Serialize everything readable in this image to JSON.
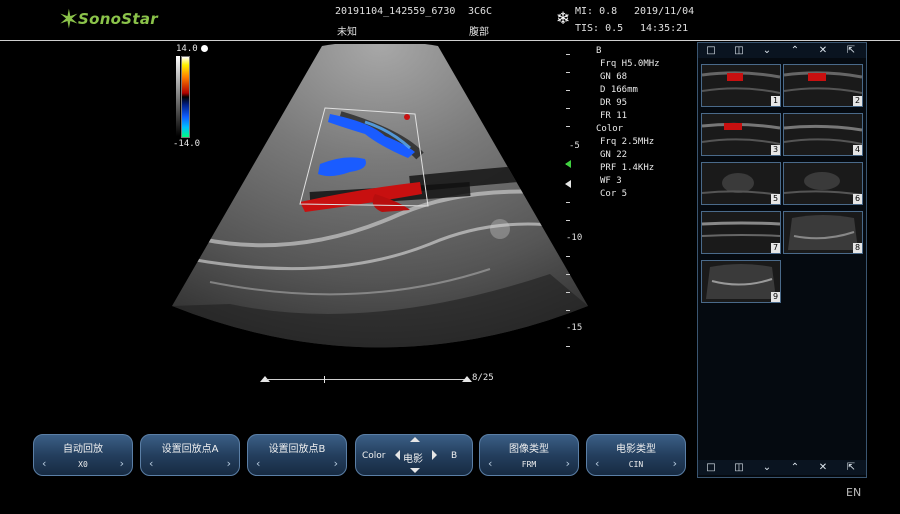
{
  "header": {
    "logo_text": "SonoStar",
    "file_id": "20191104_142559_6730",
    "probe": "3C6C",
    "patient_name": "未知",
    "exam_type": "腹部",
    "mi": "MI: 0.8",
    "tis": "TIS: 0.5",
    "date": "2019/11/04",
    "time": "14:35:21"
  },
  "colorbar": {
    "top_label": "14.0",
    "bottom_label": "-14.0"
  },
  "depth_scale": {
    "labels": [
      "-5",
      "-10",
      "-15"
    ]
  },
  "params": {
    "b_title": "B",
    "b_rows": [
      "Frq H5.0MHz",
      "GN 68",
      "D 166mm",
      "DR 95",
      "FR 11"
    ],
    "color_title": "Color",
    "color_rows": [
      "Frq 2.5MHz",
      "GN 22",
      "PRF 1.4KHz",
      "WF 3",
      "Cor 5"
    ]
  },
  "cine": {
    "frame_label": "8/25"
  },
  "thumbnails": [
    "1",
    "2",
    "3",
    "4",
    "5",
    "6",
    "7",
    "8",
    "9"
  ],
  "buttons": [
    {
      "label": "自动回放",
      "value": "X0"
    },
    {
      "label": "设置回放点A",
      "value": ""
    },
    {
      "label": "设置回放点B",
      "value": ""
    },
    {
      "label": "",
      "value": ""
    },
    {
      "label": "图像类型",
      "value": "FRM"
    },
    {
      "label": "电影类型",
      "value": "CIN"
    }
  ],
  "cine_control": {
    "left": "Color",
    "center": "电影",
    "right": "B"
  },
  "language": "EN",
  "colors": {
    "accent": "#8bc34a",
    "button": "#2a4a6e",
    "flow_red": "#c81010",
    "flow_blue": "#1a5cff"
  }
}
